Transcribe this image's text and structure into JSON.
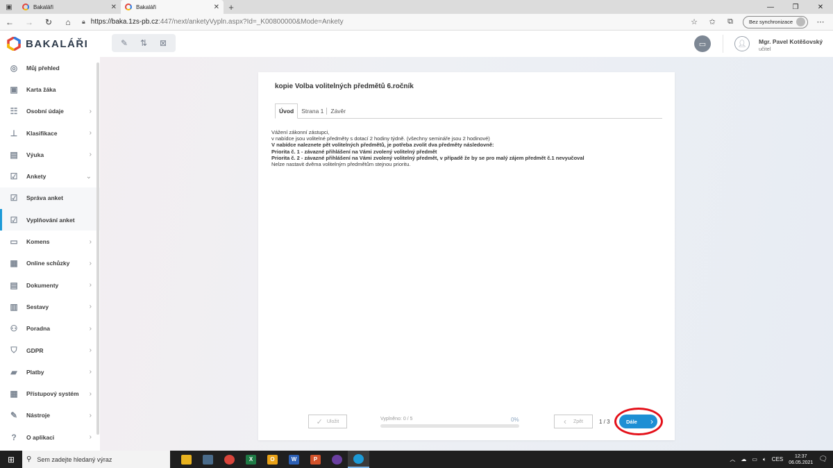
{
  "browser": {
    "tabs": [
      {
        "title": "Bakaláři",
        "active": false
      },
      {
        "title": "Bakaláři",
        "active": true
      }
    ],
    "url_host": "https://baka.1zs-pb.cz",
    "url_path": ":447/next/anketyVypln.aspx?Id=_K00800000&Mode=Ankety",
    "sync_label": "Bez synchronizace"
  },
  "app": {
    "logo_text": "BAKALÁŘI",
    "user": {
      "name": "Mgr. Pavel Kotěšovský",
      "role": "učitel"
    }
  },
  "sidebar": {
    "items": [
      {
        "label": "Můj přehled",
        "icon": "dashboard-icon",
        "chevron": false
      },
      {
        "label": "Karta žáka",
        "icon": "student-card-icon",
        "chevron": false
      },
      {
        "label": "Osobní údaje",
        "icon": "personal-data-icon",
        "chevron": true
      },
      {
        "label": "Klasifikace",
        "icon": "grades-icon",
        "chevron": true
      },
      {
        "label": "Výuka",
        "icon": "teaching-icon",
        "chevron": true
      },
      {
        "label": "Ankety",
        "icon": "survey-icon",
        "chevron": true
      },
      {
        "label": "Správa anket",
        "icon": "survey-admin-icon",
        "chevron": false
      },
      {
        "label": "Vyplňování anket",
        "icon": "survey-fill-icon",
        "chevron": false
      },
      {
        "label": "Komens",
        "icon": "messages-icon",
        "chevron": true
      },
      {
        "label": "Online schůzky",
        "icon": "meetings-icon",
        "chevron": true
      },
      {
        "label": "Dokumenty",
        "icon": "documents-icon",
        "chevron": true
      },
      {
        "label": "Sestavy",
        "icon": "reports-icon",
        "chevron": true
      },
      {
        "label": "Poradna",
        "icon": "counseling-icon",
        "chevron": true
      },
      {
        "label": "GDPR",
        "icon": "gdpr-icon",
        "chevron": true
      },
      {
        "label": "Platby",
        "icon": "payments-icon",
        "chevron": true
      },
      {
        "label": "Přístupový systém",
        "icon": "access-system-icon",
        "chevron": true
      },
      {
        "label": "Nástroje",
        "icon": "tools-icon",
        "chevron": true
      },
      {
        "label": "O aplikaci",
        "icon": "about-icon",
        "chevron": true
      }
    ]
  },
  "survey": {
    "title": "kopie Volba volitelných předmětů 6.ročník",
    "tabs": [
      "Úvod",
      "Strana 1",
      "Závěr"
    ],
    "intro": {
      "line1": "Vážení zákonní zástupci,",
      "line2": "v nabídce jsou volitelné předměty s dotací 2 hodiny týdně. (všechny semináře jsou 2 hodinové)",
      "line3": "V nabídce naleznete pět volitelných předmětů, je potřeba zvolit dva předměty následovně:",
      "line4": "Priorita č. 1 - závazné přihlášení na Vámi zvolený volitelný předmět",
      "line5": "Priorita č. 2 - závazné přihlášení na Vámi zvolený volitelný předmět, v případě že by se pro malý zájem předmět č.1 nevyučoval",
      "line6": "Nelze nastavit dvěma volitelným předmětům stejnou prioritu."
    },
    "footer": {
      "save_label": "Uložit",
      "progress_label": "Vyplněno: 0 / 5",
      "progress_pct": "0%",
      "progress_fraction": 0,
      "back_label": "Zpět",
      "page_count": "1 / 3",
      "next_label": "Dále"
    }
  },
  "taskbar": {
    "search_placeholder": "Sem zadejte hledaný výraz",
    "language": "CES",
    "time": "12:37",
    "date": "06.05.2021"
  },
  "colors": {
    "accent": "#1e8fd4",
    "active_indicator": "#1e9bd8",
    "annotation": "#e4111a"
  }
}
